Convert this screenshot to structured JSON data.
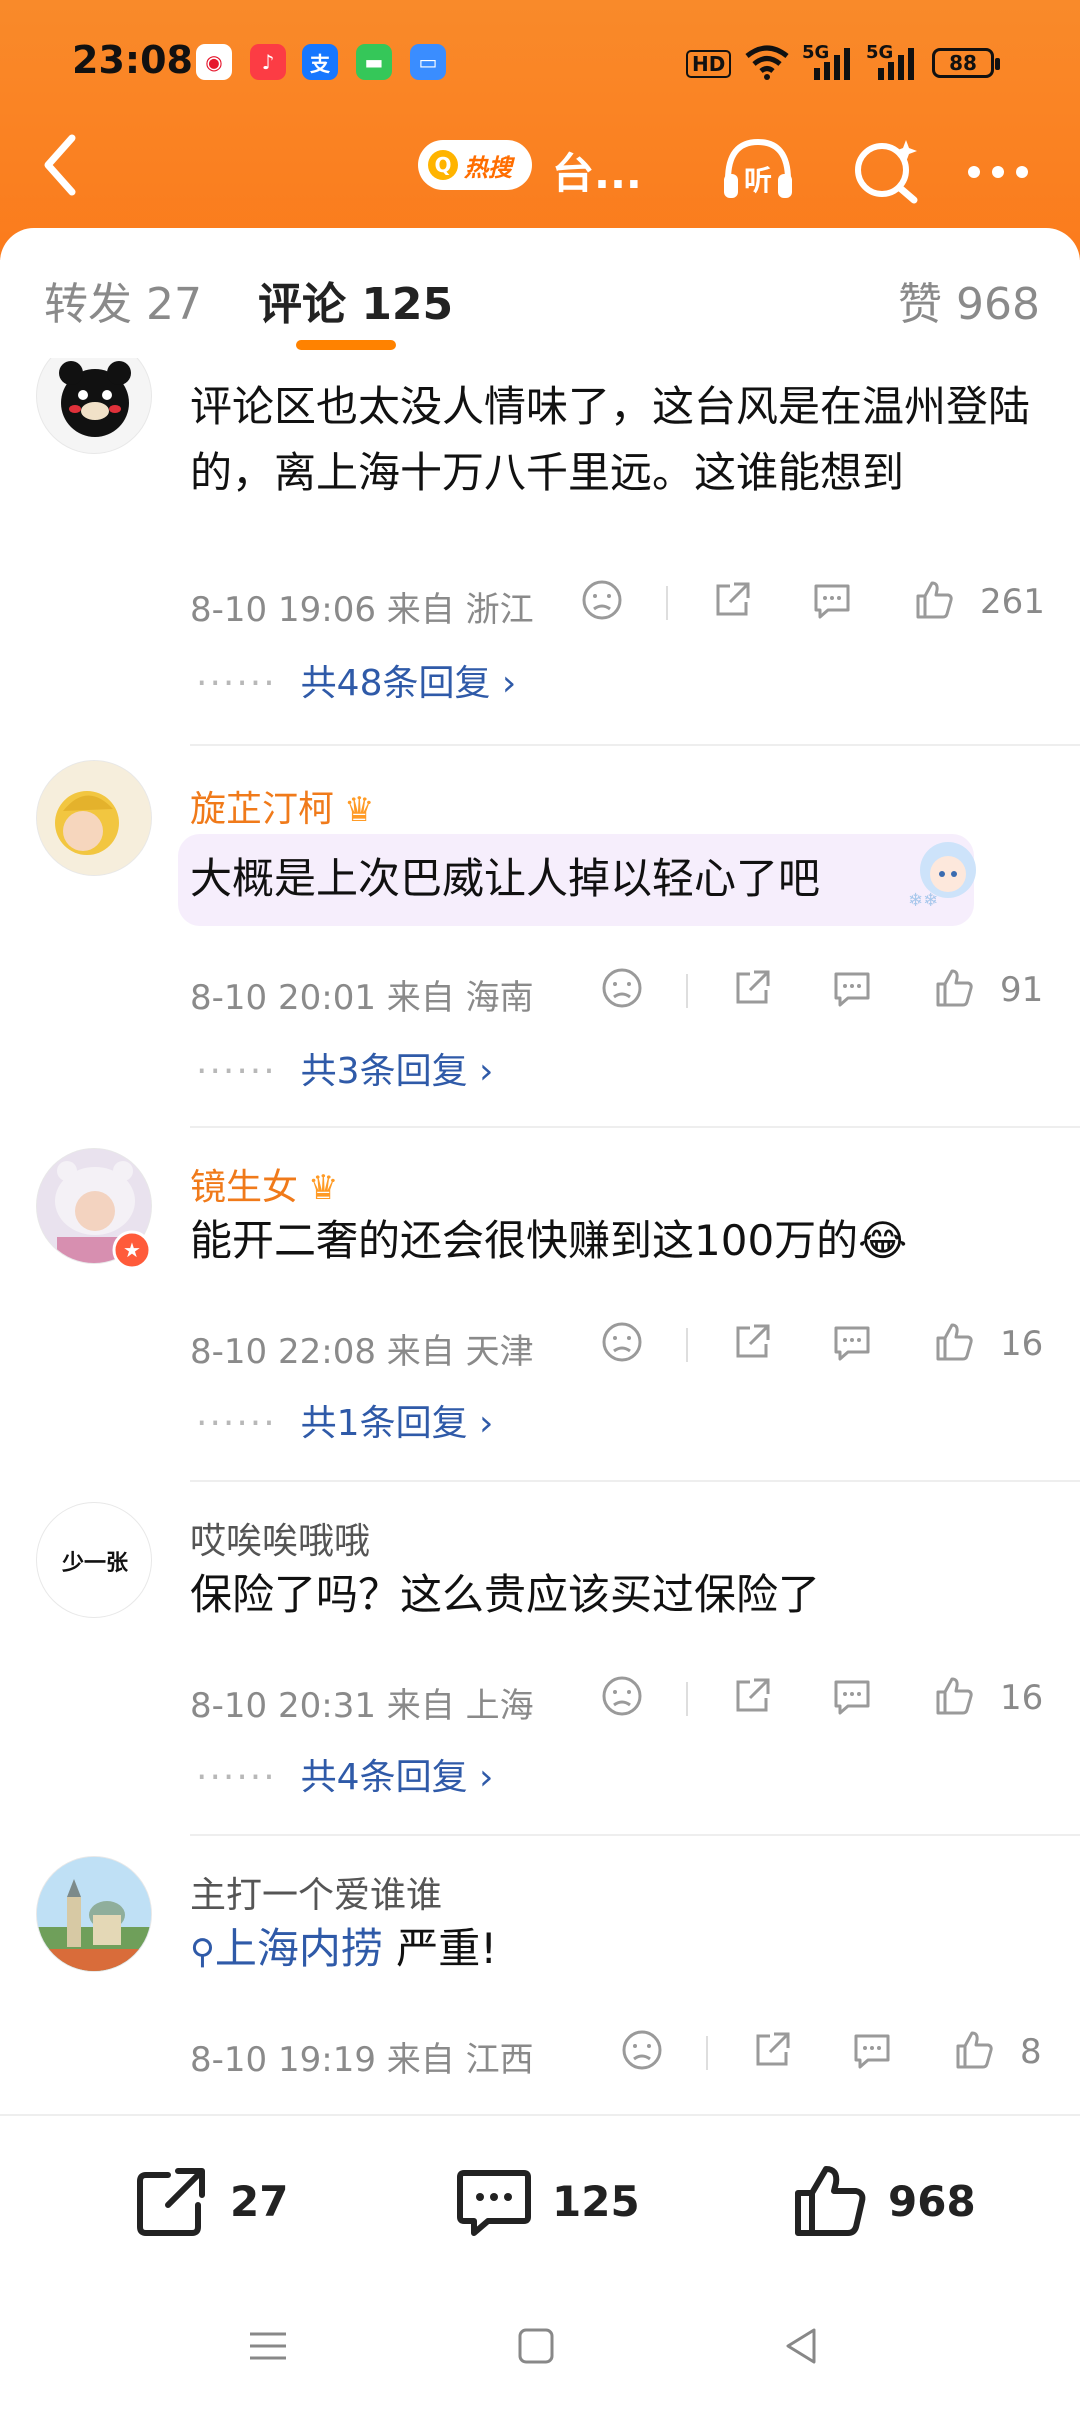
{
  "status_bar": {
    "time": "23:08",
    "hd": "HD",
    "net1": "5G",
    "net2": "5G",
    "battery": "88"
  },
  "nav": {
    "hot_search_label": "热搜",
    "title": "台..."
  },
  "tabs": {
    "repost": "转发 27",
    "comment": "评论 125",
    "like": "赞 968"
  },
  "comments": [
    {
      "username": "",
      "text": "评论区也太没人情味了，这台风是在温州登陆的，离上海十万八千里远。这谁能想到",
      "date": "8-10 19:06",
      "location": "来自 浙江",
      "likes": "261",
      "replies": "共48条回复"
    },
    {
      "username": "旋芷汀柯",
      "text": "大概是上次巴威让人掉以轻心了吧",
      "date": "8-10 20:01",
      "location": "来自 海南",
      "likes": "91",
      "replies": "共3条回复"
    },
    {
      "username": "镜生女",
      "text": "能开二奢的还会很快赚到这100万的😂",
      "date": "8-10 22:08",
      "location": "来自 天津",
      "likes": "16",
      "replies": "共1条回复"
    },
    {
      "username": "哎唉唉哦哦",
      "text": "保险了吗？这么贵应该买过保险了",
      "date": "8-10 20:31",
      "location": "来自 上海",
      "likes": "16",
      "replies": "共4条回复",
      "avatar_text": "少一张"
    },
    {
      "username": "主打一个爱谁谁",
      "hashtag": "上海内捞",
      "text_after": " 严重!",
      "date": "8-10 19:19",
      "location": "来自 江西",
      "likes": "8"
    }
  ],
  "action_bar": {
    "repost_count": "27",
    "comment_count": "125",
    "like_count": "968"
  },
  "colors": {
    "accent": "#ff8200",
    "header": "#fb7b1c",
    "link": "#2f5aa8",
    "vip_name": "#f07a1a"
  }
}
